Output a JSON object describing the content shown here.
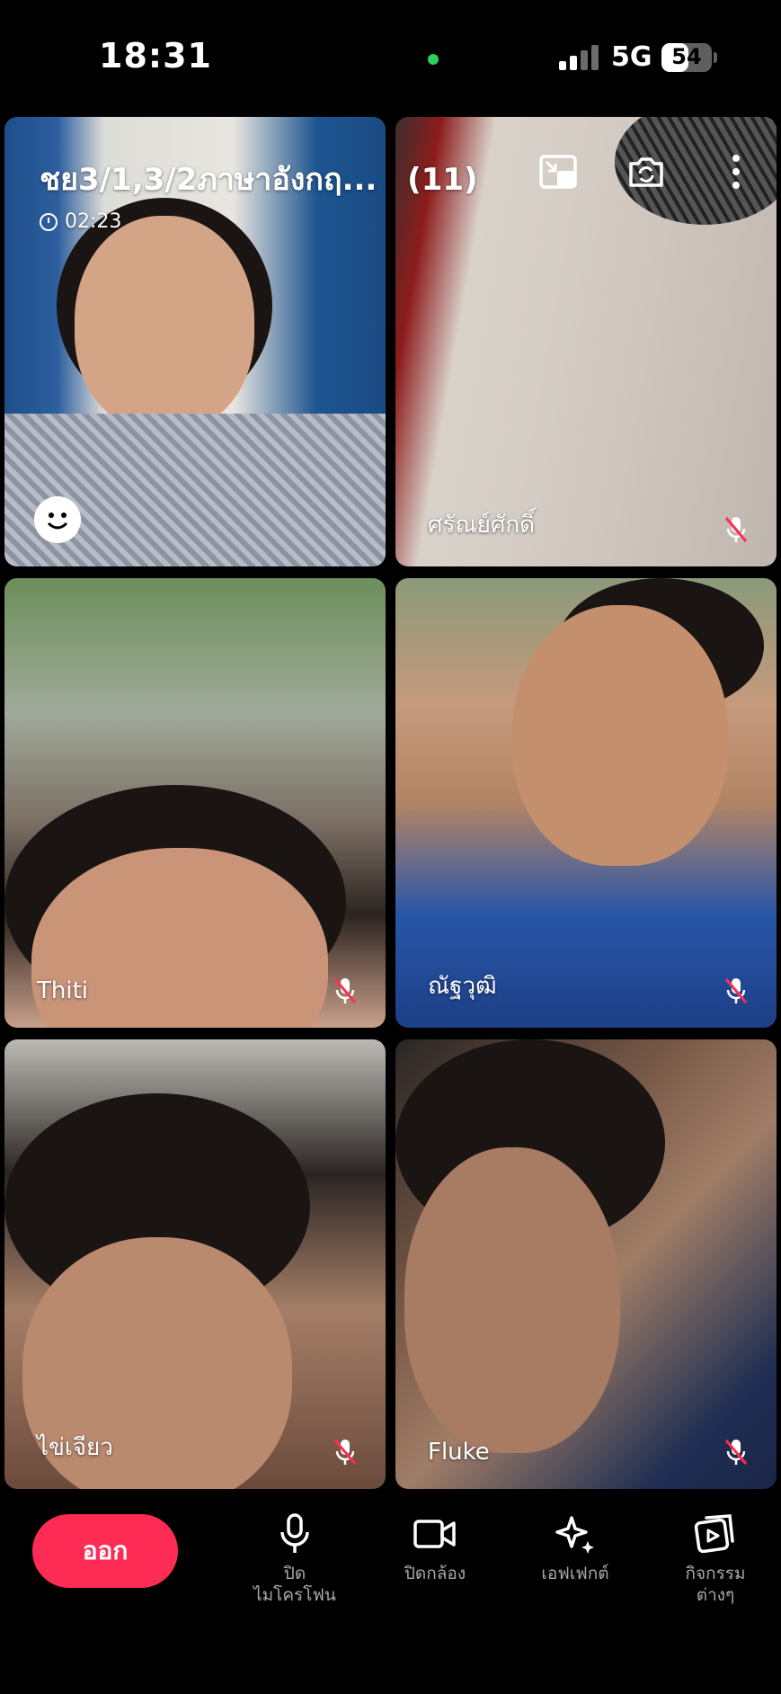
{
  "status_bar": {
    "time": "18:31",
    "network": "5G",
    "battery": "54",
    "battery_level": 0.54
  },
  "call": {
    "title": "ชย3/1,3/2ภาษาอังกฤ...",
    "count": "(11)",
    "duration": "02:23"
  },
  "participants": [
    {
      "name": ""
    },
    {
      "name": "ศรัณย์ศักดิ์",
      "muted": true
    },
    {
      "name": "Thiti",
      "muted": true
    },
    {
      "name": "ณัฐวุฒิ",
      "muted": true
    },
    {
      "name": "ไข่เจียว",
      "muted": true
    },
    {
      "name": "Fluke",
      "muted": true
    }
  ],
  "controls": {
    "leave": "ออก",
    "mic": [
      "ปิด",
      "ไมโครโฟน"
    ],
    "camera": "ปิดกล้อง",
    "effects": "เอฟเฟกต์",
    "activities": [
      "กิจกรรม",
      "ต่างๆ"
    ]
  },
  "icons": {
    "minimize": "minimize-window-icon",
    "flip_camera": "flip-camera-icon",
    "more": "more-vertical-icon",
    "emoji": "emoji-icon",
    "mic_off": "mic-off-icon",
    "clock": "clock-icon"
  },
  "colors": {
    "leave": "#fe2c55",
    "camera_indicator": "#2ed158",
    "mute_icon": "#fe2c55"
  }
}
